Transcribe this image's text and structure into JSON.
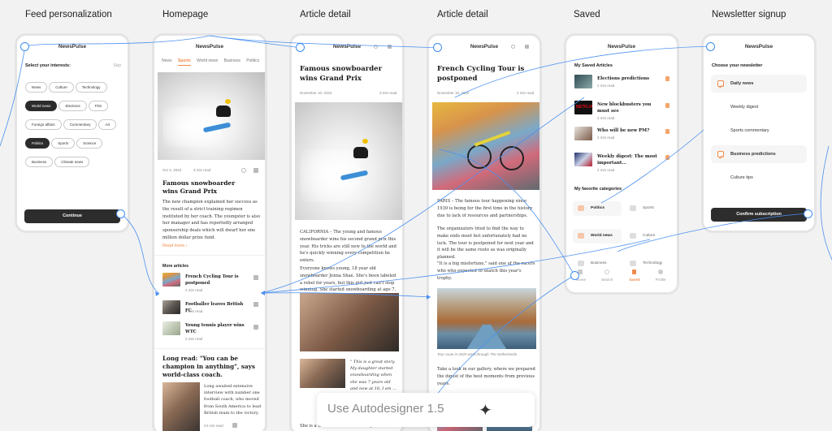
{
  "columns": [
    "Feed personalization",
    "Homepage",
    "Article detail",
    "Article detail",
    "Saved",
    "Newsletter signup"
  ],
  "brand": "NewsPulse",
  "feed": {
    "heading": "Select your interests:",
    "skip": "Skip",
    "chips_row1": [
      "News",
      "Culture",
      "Technology"
    ],
    "chips_row2": [
      "World news",
      "Elections",
      "Film"
    ],
    "chips_row3": [
      "Foreign affairs",
      "Commentary",
      "Art"
    ],
    "chips_row4": [
      "Politics",
      "Sports",
      "Science"
    ],
    "chips_row5": [
      "Business",
      "Climate news"
    ],
    "selected": [
      "World news",
      "Politics"
    ],
    "button": "Continue"
  },
  "home": {
    "tabs": [
      "News",
      "Sports",
      "World news",
      "Business",
      "Politics"
    ],
    "active_tab": "Sports",
    "date": "Oct 4, 2022",
    "read_time": "3 min read",
    "headline": "Famous snowboarder wins Grand Prix",
    "body": "The new champion explained her success as the result of a strict training regimen instituted by her coach. The youngster is also her manager and has reportedly arranged sponsorship deals which will dwarf her one million dollar prize fund.",
    "read_more": "Read more",
    "more_heading": "More articles",
    "more": [
      {
        "title": "French Cycling Tour is postponed",
        "meta": "2 min read"
      },
      {
        "title": "Footballer leaves British FC",
        "meta": "2 min read"
      },
      {
        "title": "Young tennis player wins WTC",
        "meta": "2 min read"
      }
    ],
    "long_read": "Long read: \"You can be champion in anything\", says world-class coach.",
    "long_body": "Long awaited extensive interview with number one football coach, who moved from South America to lead British team to the victory.",
    "long_meta": "24 min read"
  },
  "article1": {
    "title": "Famous snowboarder wins Grand Prix",
    "date": "November 10, 2022",
    "read_time": "3 min read",
    "p1": "CALIFORNIA – The young and famous snowboarder wins his second grand prix this year. His tricks are still new to the world and he's quickly winning every competition he enters.",
    "p2": "Everyone knows young, 18 year old snowboarder Jenna Shae. She's been labeled a rebel for years, but this girl just can't stop winning. She started snowboarding at age 7, and now wins grand prix races with ease. At age 18 she is still going strong, and will hopefully keep that hot streak alive well into adulthood.",
    "quote": "\" This is a great story. My daughter started snowboarding when she was 7 years old and now at 18, I am ...",
    "p3": "She is a trained athlete who competed in many ..."
  },
  "article2": {
    "title": "French Cycling Tour is postponed",
    "date": "November 10, 2022",
    "read_time": "2 min read",
    "p1": "PARIS – The famous tour happening since 1939 is being for the first time in the history due to lack of resources and partnerships.",
    "p2": "The organizators tried to find the way to make ends meet but unfortunately had no luck. The tour is postponed for next year and it will be the same route as was originally planned.",
    "p3": "\"It is a big misfortune,\" said one of the racers who who expected to snatch this year's trophy.",
    "caption": "Tour route in 2020 went through The Netherlands.",
    "p4": "Take a look in our gallery, where we prepared the digest of the best moments from previous years."
  },
  "saved": {
    "heading": "My Saved Articles",
    "items": [
      {
        "title": "Elections predictions",
        "meta": "2 min read"
      },
      {
        "title": "New blockbusters you must see",
        "meta": "2 min read"
      },
      {
        "title": "Who will be new PM?",
        "meta": "2 min read"
      },
      {
        "title": "Weekly digest: The most important...",
        "meta": "2 min read"
      }
    ],
    "cat_heading": "My favorite categories",
    "cats": [
      "Politics",
      "Sports",
      "World news",
      "Culture",
      "Business",
      "Technology"
    ],
    "tabbar": [
      "Home",
      "Search",
      "Saved",
      "Profile"
    ]
  },
  "newsletter": {
    "heading": "Choose your newsletter",
    "items": [
      "Daily news",
      "Weekly digest",
      "Sports commentary",
      "Business predictions",
      "Culture tips"
    ],
    "button": "Confirm subscription"
  },
  "cta": "Use Autodesigner 1.5",
  "colors": {
    "accent": "#f08a4b",
    "connector": "#3d8cf0",
    "dark": "#2d2d2d"
  }
}
